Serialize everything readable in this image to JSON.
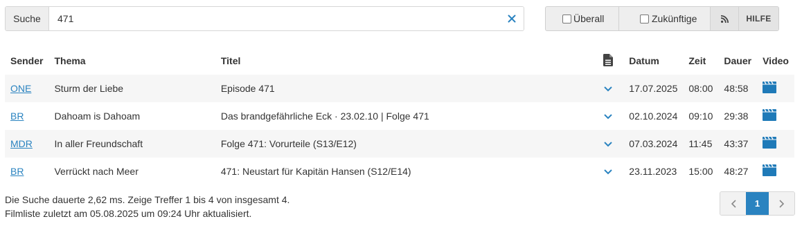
{
  "search": {
    "label": "Suche",
    "value": "471"
  },
  "options": {
    "everywhere_label": "Überall",
    "future_label": "Zukünftige",
    "help_label": "HILFE"
  },
  "table": {
    "headers": {
      "sender": "Sender",
      "thema": "Thema",
      "titel": "Titel",
      "datum": "Datum",
      "zeit": "Zeit",
      "dauer": "Dauer",
      "video": "Video"
    },
    "rows": [
      {
        "sender": "ONE",
        "thema": "Sturm der Liebe",
        "titel": "Episode 471",
        "datum": "17.07.2025",
        "zeit": "08:00",
        "dauer": "48:58"
      },
      {
        "sender": "BR",
        "thema": "Dahoam is Dahoam",
        "titel": "Das brandgefährliche Eck · 23.02.10 | Folge 471",
        "datum": "02.10.2024",
        "zeit": "09:10",
        "dauer": "29:38"
      },
      {
        "sender": "MDR",
        "thema": "In aller Freundschaft",
        "titel": "Folge 471: Vorurteile (S13/E12)",
        "datum": "07.03.2024",
        "zeit": "11:45",
        "dauer": "43:37"
      },
      {
        "sender": "BR",
        "thema": "Verrückt nach Meer",
        "titel": "471: Neustart für Kapitän Hansen (S12/E14)",
        "datum": "23.11.2023",
        "zeit": "15:00",
        "dauer": "48:27"
      }
    ]
  },
  "footer": {
    "search_info": "Die Suche dauerte 2,62 ms. Zeige Treffer 1 bis 4 von insgesamt 4.",
    "list_info": "Filmliste zuletzt am 05.08.2025 um 09:24 Uhr aktualisiert."
  },
  "pagination": {
    "current_page": "1"
  },
  "icons": {
    "clear": "close-icon",
    "rss": "rss-icon",
    "description": "document-icon",
    "expand": "chevron-down-icon",
    "video": "video-clapper-icon",
    "prev": "chevron-left-icon",
    "next": "chevron-right-icon"
  },
  "colors": {
    "accent": "#2a83c0",
    "row_stripe": "#f6f6f6",
    "button_bg": "#eeeeee"
  }
}
